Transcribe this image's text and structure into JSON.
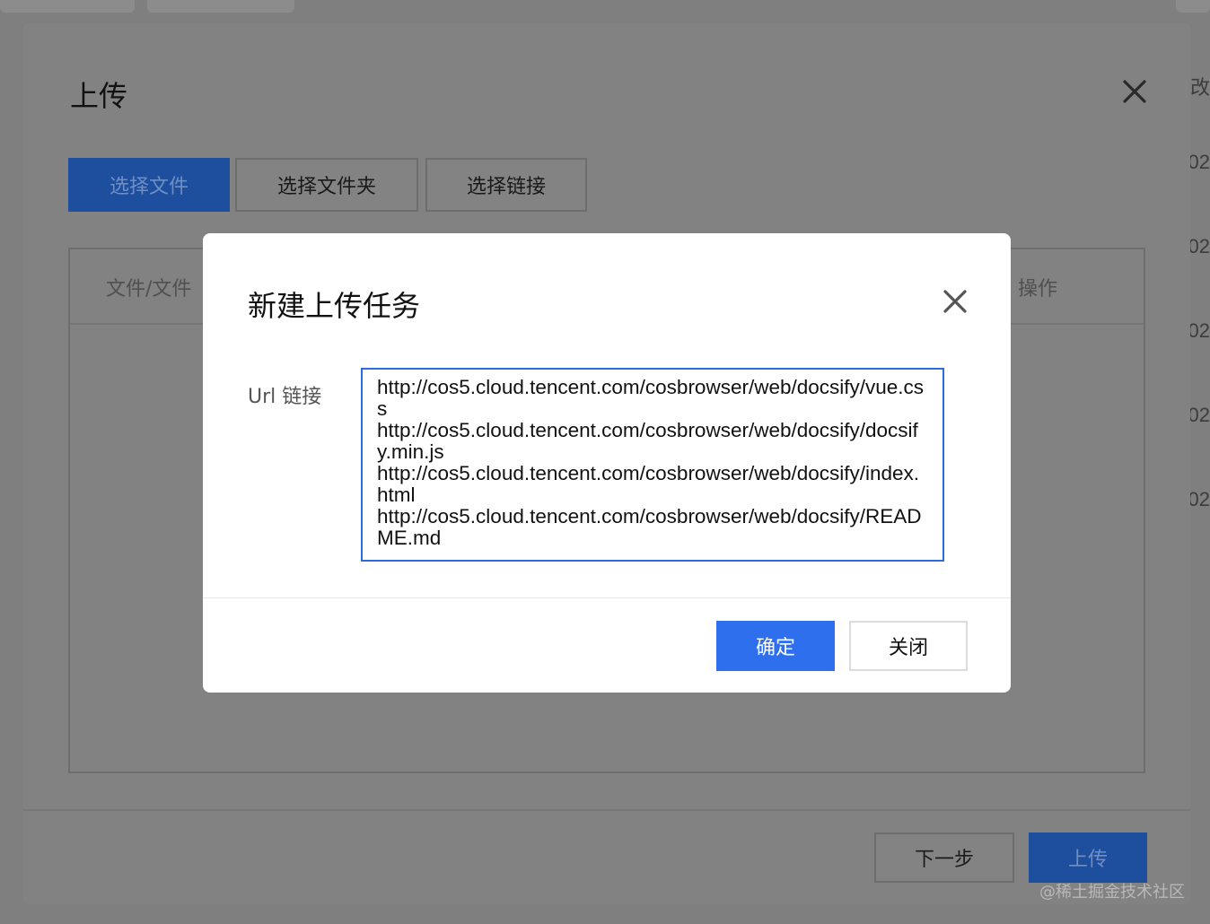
{
  "background": {
    "right_fragments": [
      "改",
      "02",
      "02",
      "02",
      "02",
      "02"
    ]
  },
  "outer_dialog": {
    "title": "上传",
    "buttons": {
      "select_file": "选择文件",
      "select_folder": "选择文件夹",
      "select_link": "选择链接"
    },
    "table": {
      "columns": [
        "文件/文件",
        "操作"
      ]
    },
    "footer": {
      "next": "下一步",
      "upload": "上传"
    }
  },
  "modal": {
    "title": "新建上传任务",
    "url_label": "Url 链接",
    "url_value": "http://cos5.cloud.tencent.com/cosbrowser/web/docsify/vue.css\nhttp://cos5.cloud.tencent.com/cosbrowser/web/docsify/docsify.min.js\nhttp://cos5.cloud.tencent.com/cosbrowser/web/docsify/index.html\nhttp://cos5.cloud.tencent.com/cosbrowser/web/docsify/README.md",
    "confirm": "确定",
    "close": "关闭"
  },
  "watermark": "@稀土掘金技术社区",
  "colors": {
    "primary": "#2d6fec",
    "input_focus": "#2b6bdc",
    "overlay": "#7f7f7f"
  }
}
